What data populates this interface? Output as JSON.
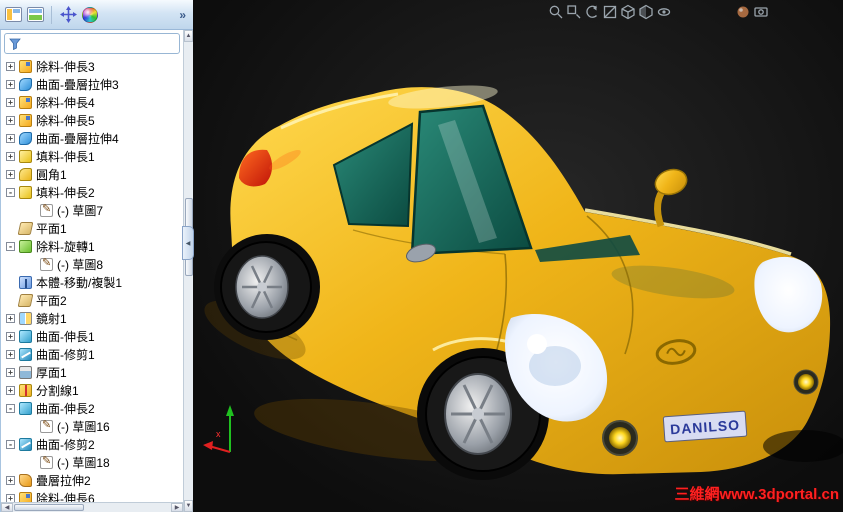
{
  "toolbar": {
    "overflow_chevron": "»",
    "icons": [
      {
        "name": "feature-pane-icon"
      },
      {
        "name": "display-pane-icon"
      },
      {
        "name": "move-icon"
      },
      {
        "name": "color-sphere-icon"
      }
    ]
  },
  "feature_panel": {
    "filter": {
      "placeholder": "",
      "icon": "filter-funnel-icon"
    },
    "items": [
      {
        "label": "除料-伸長3",
        "icon": "cut-extrude",
        "expand": "plus",
        "child": false
      },
      {
        "label": "曲面-疊層拉伸3",
        "icon": "surface-loft",
        "expand": "plus",
        "child": false
      },
      {
        "label": "除料-伸長4",
        "icon": "cut-extrude",
        "expand": "plus",
        "child": false
      },
      {
        "label": "除料-伸長5",
        "icon": "cut-extrude",
        "expand": "plus",
        "child": false
      },
      {
        "label": "曲面-疊層拉伸4",
        "icon": "surface-loft",
        "expand": "plus",
        "child": false
      },
      {
        "label": "填料-伸長1",
        "icon": "boss-extrude",
        "expand": "plus",
        "child": false
      },
      {
        "label": "圓角1",
        "icon": "fillet",
        "expand": "plus",
        "child": false
      },
      {
        "label": "填料-伸長2",
        "icon": "boss-extrude",
        "expand": "minus",
        "child": false
      },
      {
        "label": "(-) 草圖7",
        "icon": "sketch",
        "expand": "none",
        "child": true
      },
      {
        "label": "平面1",
        "icon": "plane",
        "expand": "none",
        "child": false
      },
      {
        "label": "除料-旋轉1",
        "icon": "cut-revolve",
        "expand": "minus",
        "child": false
      },
      {
        "label": "(-) 草圖8",
        "icon": "sketch",
        "expand": "none",
        "child": true
      },
      {
        "label": "本體-移動/複製1",
        "icon": "move-copy",
        "expand": "none",
        "child": false
      },
      {
        "label": "平面2",
        "icon": "plane",
        "expand": "none",
        "child": false
      },
      {
        "label": "鏡射1",
        "icon": "mirror",
        "expand": "plus",
        "child": false
      },
      {
        "label": "曲面-伸長1",
        "icon": "surface-extrude",
        "expand": "plus",
        "child": false
      },
      {
        "label": "曲面-修剪1",
        "icon": "surface-trim",
        "expand": "plus",
        "child": false
      },
      {
        "label": "厚面1",
        "icon": "thicken",
        "expand": "plus",
        "child": false
      },
      {
        "label": "分割線1",
        "icon": "split-line",
        "expand": "plus",
        "child": false
      },
      {
        "label": "曲面-伸長2",
        "icon": "surface-extrude",
        "expand": "minus",
        "child": false
      },
      {
        "label": "(-) 草圖16",
        "icon": "sketch",
        "expand": "none",
        "child": true
      },
      {
        "label": "曲面-修剪2",
        "icon": "surface-trim",
        "expand": "minus",
        "child": false
      },
      {
        "label": "(-) 草圖18",
        "icon": "sketch",
        "expand": "none",
        "child": true
      },
      {
        "label": "疊層拉伸2",
        "icon": "loft",
        "expand": "plus",
        "child": false
      },
      {
        "label": "除料-伸長6",
        "icon": "cut-extrude",
        "expand": "plus",
        "child": false
      }
    ]
  },
  "viewport": {
    "hud_icons": [
      {
        "name": "zoom-fit-icon"
      },
      {
        "name": "zoom-area-icon"
      },
      {
        "name": "previous-view-icon"
      },
      {
        "name": "section-view-icon"
      },
      {
        "name": "view-orientation-icon"
      },
      {
        "name": "display-style-icon"
      },
      {
        "name": "hide-show-icon"
      }
    ],
    "hud_icons_right": [
      {
        "name": "appearance-icon"
      },
      {
        "name": "scene-icon"
      }
    ],
    "license_plate": "DANILSO",
    "watermark": "三維網www.3dportal.cn",
    "triad": {
      "x_label": "x"
    },
    "colors": {
      "car_body": "#f0b51a",
      "glass": "#176b5f",
      "background": "#1a1a1a",
      "watermark_red": "#ff2020"
    }
  }
}
